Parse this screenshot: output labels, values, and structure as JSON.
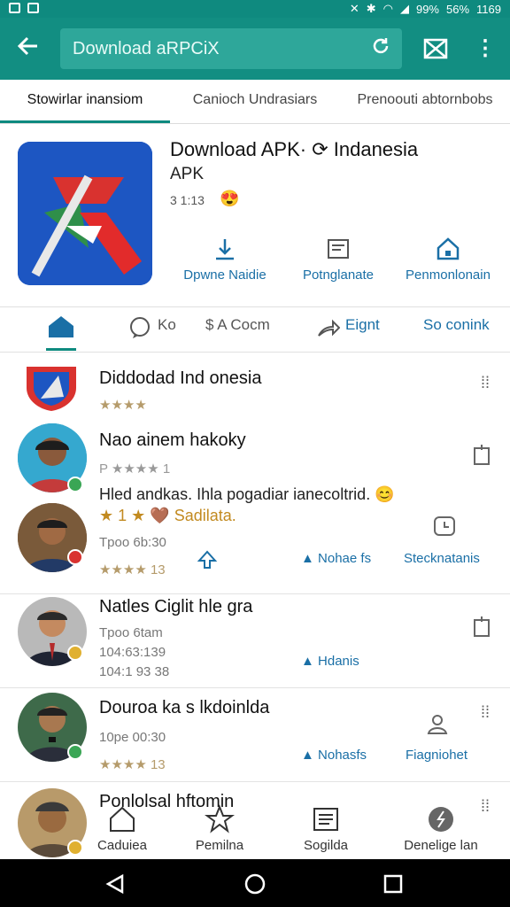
{
  "status_bar": {
    "icons": [
      "image-icon",
      "image-icon",
      "mute-icon",
      "bluetooth-icon",
      "wifi-icon",
      "signal-icon"
    ],
    "battery": "99%",
    "signal_pct": "56%",
    "time": "1169"
  },
  "app_bar": {
    "search_value": "Download aRPCiX",
    "colors": {
      "bar": "#128e82",
      "accent": "#0e8a7f",
      "link": "#1a6fa6"
    }
  },
  "tabs": [
    {
      "label": "Stowirlar inansiom",
      "active": true
    },
    {
      "label": "Canioch Undrasiars",
      "active": false
    },
    {
      "label": "Prenoouti abtornbobs",
      "active": false
    }
  ],
  "app": {
    "title": "Download APK· ⟳ Indanesia",
    "subtitle": "APK",
    "meta": "3 1:13",
    "emoji": "😍",
    "actions": [
      {
        "label": "Dpwne Naidie",
        "icon": "download-icon"
      },
      {
        "label": "Potnglanate",
        "icon": "document-icon"
      },
      {
        "label": "Penmonlonain",
        "icon": "home-icon"
      }
    ]
  },
  "subnav": {
    "items": [
      "Ko",
      "$ A Cocm",
      "Eignt",
      "So conink"
    ]
  },
  "feed": {
    "app_row": {
      "name": "Diddodad Ind onesia",
      "stars": "★★★★"
    },
    "rows": [
      {
        "name": "Nao ainem hakoky",
        "rating": "P ★★★★ 1",
        "comment": "Hled andkas. Ihla pogadiar ianecoltrid. 😊"
      },
      {
        "stars_line": "★ 1 ★ 🤎 Sadilata.",
        "time": "Tpoo 6b:30",
        "stars": "★★★★ 13",
        "actions": [
          "Nohae fs",
          "Stecknatanis"
        ]
      },
      {
        "name": "Natles Ciglit hle gra",
        "time": "Tpoo 6tam",
        "line2": "104:63:139",
        "line3": "104:1 93 38",
        "action": "Hdanis"
      },
      {
        "name": "Douroa ka s lkdoinlda",
        "time": "10pe 00:30",
        "stars": "★★★★ 13",
        "actions": [
          "Nohasfs",
          "Fiagniohet"
        ]
      },
      {
        "name": "Ponlolsal hftomin"
      }
    ]
  },
  "bottom_toolbar": [
    {
      "label": "Caduiea",
      "icon": "home-outline-icon"
    },
    {
      "label": "Pemilna",
      "icon": "star-wrench-icon"
    },
    {
      "label": "Sogilda",
      "icon": "list-icon"
    },
    {
      "label": "Denelige lan",
      "icon": "compass-icon"
    }
  ]
}
